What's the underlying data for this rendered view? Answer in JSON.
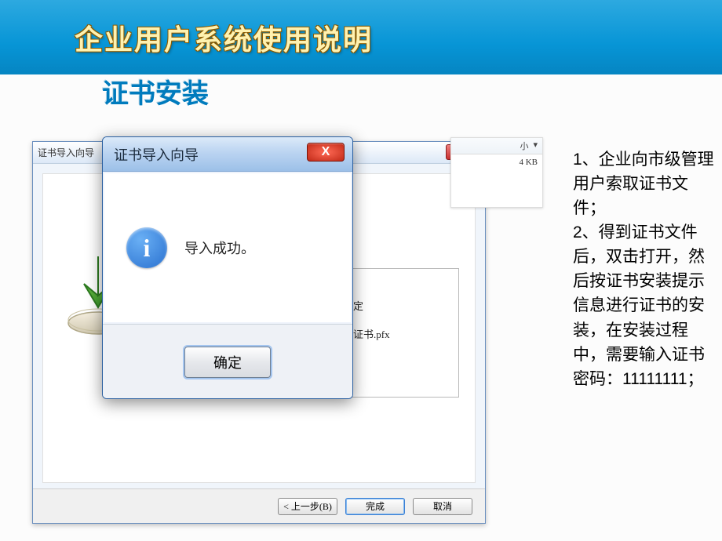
{
  "banner": {
    "title": "企业用户系统使用说明"
  },
  "subtitle": "证书安装",
  "back_wizard": {
    "title": "证书导入向导",
    "panel_text": "定",
    "file_text": "证书.pfx",
    "buttons": {
      "prev": "< 上一步(B)",
      "finish": "完成",
      "cancel": "取消"
    }
  },
  "file_snip": {
    "col_label": "小",
    "arrow": "▾",
    "size": "4 KB"
  },
  "dialog": {
    "title": "证书导入向导",
    "message": "导入成功。",
    "ok": "确定",
    "close_glyph": "X"
  },
  "instructions": "1、企业向市级管理用户索取证书文件；\n2、得到证书文件后，双击打开，然后按证书安装提示信息进行证书的安装，在安装过程中，需要输入证书密码：11111111；"
}
